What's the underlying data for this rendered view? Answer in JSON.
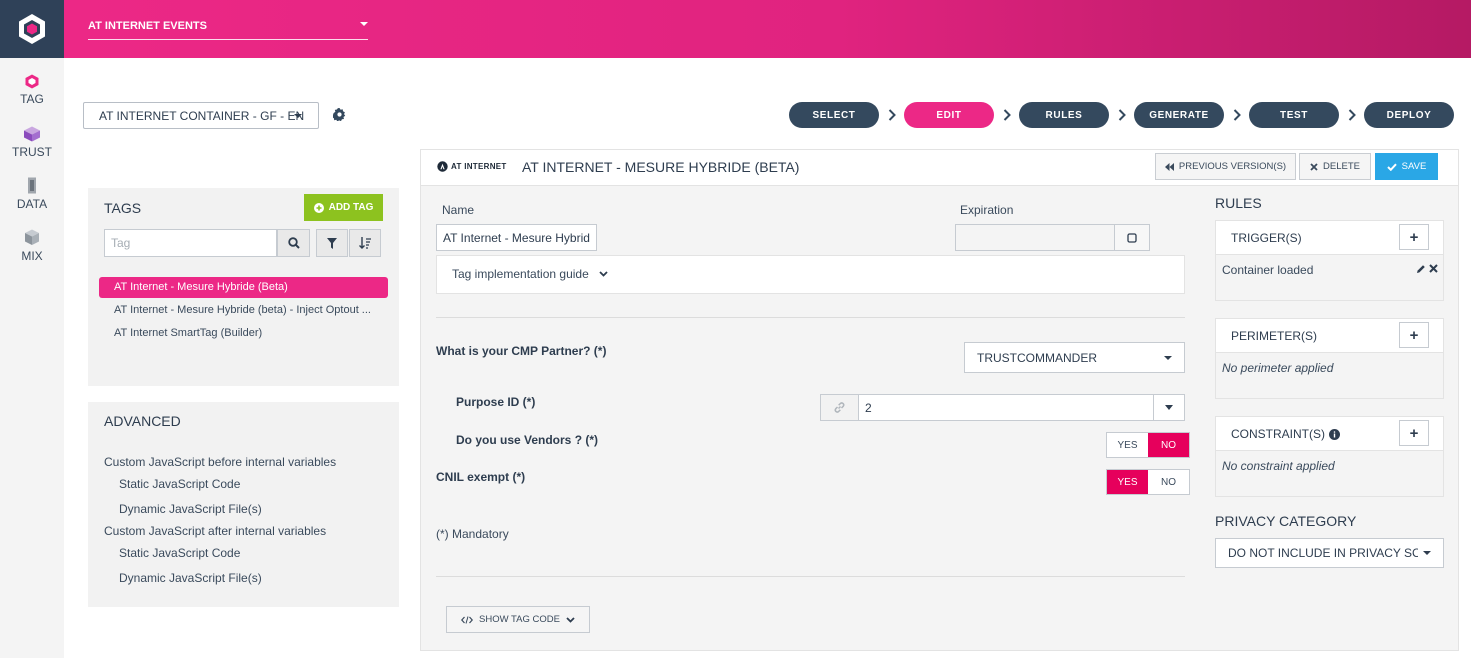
{
  "rail": {
    "items": [
      {
        "label": "TAG"
      },
      {
        "label": "TRUST"
      },
      {
        "label": "DATA"
      },
      {
        "label": "MIX"
      }
    ]
  },
  "header": {
    "environment": "AT INTERNET EVENTS"
  },
  "container": {
    "selected": "AT INTERNET CONTAINER - GF - EN"
  },
  "steps": [
    "SELECT",
    "EDIT",
    "RULES",
    "GENERATE",
    "TEST",
    "DEPLOY"
  ],
  "tags": {
    "title": "TAGS",
    "add_label": "ADD TAG",
    "search_placeholder": "Tag",
    "items": [
      "AT Internet - Mesure Hybride (Beta)",
      "AT Internet - Mesure Hybride (beta) - Inject Optout ...",
      "AT Internet SmartTag (Builder)"
    ]
  },
  "advanced": {
    "title": "ADVANCED",
    "items": [
      "Custom JavaScript before internal variables",
      "Static JavaScript Code",
      "Dynamic JavaScript File(s)",
      "Custom JavaScript after internal variables",
      "Static JavaScript Code",
      "Dynamic JavaScript File(s)"
    ]
  },
  "editor": {
    "brand": "AT INTERNET",
    "title": "AT INTERNET - MESURE HYBRIDE (BETA)",
    "prev_versions": "PREVIOUS VERSION(S)",
    "delete": "DELETE",
    "save": "SAVE",
    "name_label": "Name",
    "name_value": "AT Internet - Mesure Hybrid",
    "expiration_label": "Expiration",
    "guide": "Tag implementation guide",
    "cmp_label": "What is your CMP Partner? (*)",
    "cmp_value": "TRUSTCOMMANDER",
    "purpose_label": "Purpose ID (*)",
    "purpose_value": "2",
    "vendors_label": "Do you use Vendors ? (*)",
    "cnil_label": "CNIL exempt (*)",
    "yes": "YES",
    "no": "NO",
    "mandatory": "(*) Mandatory",
    "show_code": "SHOW TAG CODE"
  },
  "rules": {
    "title": "RULES",
    "triggers_title": "TRIGGER(S)",
    "trigger_item": "Container loaded",
    "perimeter_title": "PERIMETER(S)",
    "perimeter_empty": "No perimeter applied",
    "constraint_title": "CONSTRAINT(S)",
    "constraint_empty": "No constraint applied",
    "privacy_title": "PRIVACY CATEGORY",
    "privacy_value": "DO NOT INCLUDE IN PRIVACY SC"
  }
}
